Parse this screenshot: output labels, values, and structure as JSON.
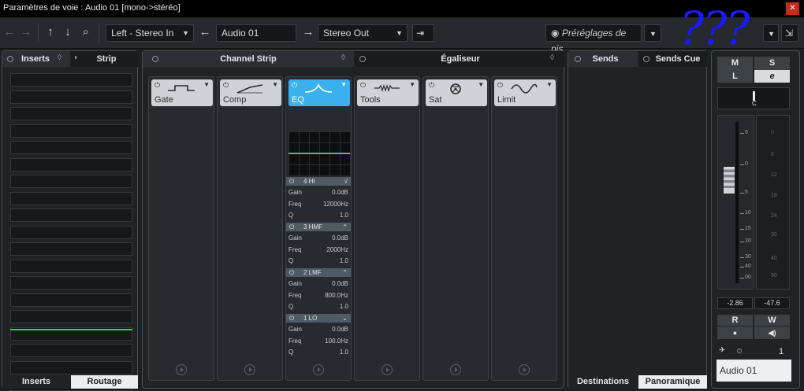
{
  "window": {
    "title": "Paramètres de voie : Audio 01 [mono->stéréo]",
    "close_icon": "close-icon"
  },
  "toolbar": {
    "input_routing": "Left - Stereo In",
    "track_name": "Audio 01",
    "output_routing": "Stereo Out",
    "presets_placeholder": "Préréglages de pis."
  },
  "inserts": {
    "tab_inserts": "Inserts",
    "tab_strip": "Strip",
    "footer_inserts": "Inserts",
    "footer_routing": "Routage",
    "slot_count": 19
  },
  "channel_strip": {
    "tab_channel_strip": "Channel Strip",
    "tab_equalizer": "Égaliseur",
    "modules": [
      "Gate",
      "Comp",
      "EQ",
      "Tools",
      "Sat",
      "Limit"
    ],
    "eq_bands": [
      {
        "name": "4 HI",
        "gain": "0.0dB",
        "freq": "12000Hz",
        "q": "1.0"
      },
      {
        "name": "3 HMF",
        "gain": "0.0dB",
        "freq": "2000Hz",
        "q": "1.0"
      },
      {
        "name": "2 LMF",
        "gain": "0.0dB",
        "freq": "800.0Hz",
        "q": "1.0"
      },
      {
        "name": "1 LO",
        "gain": "0.0dB",
        "freq": "100.0Hz",
        "q": "1.0"
      }
    ],
    "param_labels": {
      "gain": "Gain",
      "freq": "Freq",
      "q": "Q"
    }
  },
  "sends": {
    "tab_sends": "Sends",
    "tab_sends_cue": "Sends Cue",
    "footer_destinations": "Destinations",
    "footer_panoramique": "Panoramique"
  },
  "fader": {
    "mute": "M",
    "solo": "S",
    "listen": "L",
    "edit": "e",
    "pan_label": "C",
    "fader_scale": [
      "6",
      "0",
      "5",
      "10",
      "15",
      "20",
      "30",
      "40",
      "00"
    ],
    "meter_scale": [
      "0",
      "6",
      "12",
      "18",
      "24",
      "30",
      "40",
      "50"
    ],
    "volume_value": "-2.86",
    "peak_value": "-47.6",
    "read": "R",
    "write": "W",
    "channel_number": "1",
    "channel_name": "Audio 01"
  },
  "annotation": {
    "marks": "???",
    "color": "#1a1aff"
  },
  "colors": {
    "accent": "#3ab0ee",
    "meter_green": "#33d24a",
    "background": "#1d2023"
  }
}
